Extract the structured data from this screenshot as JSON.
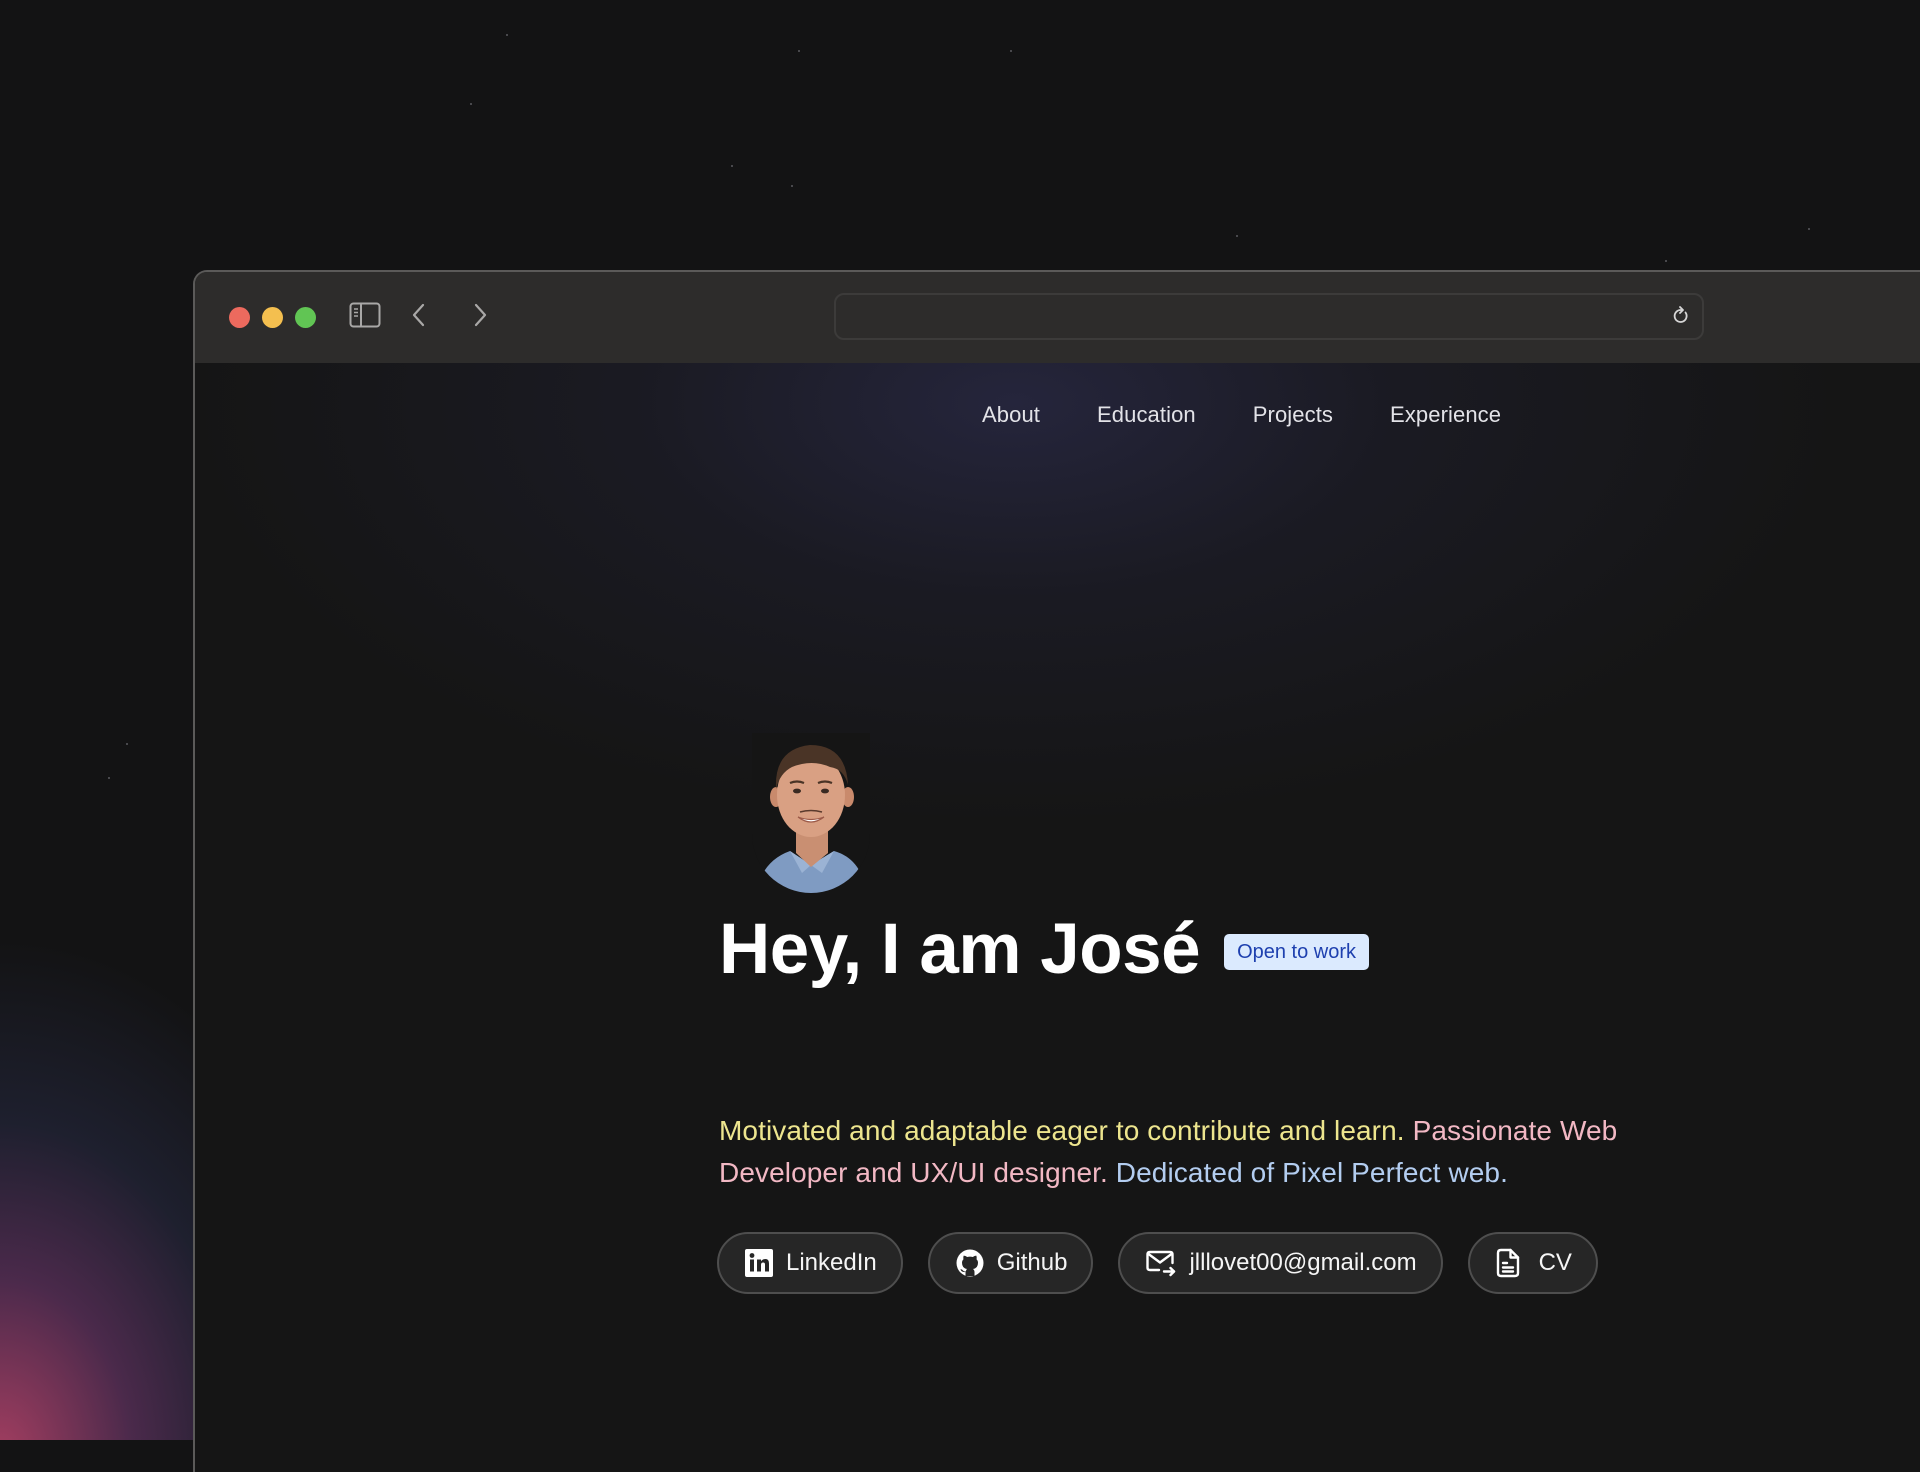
{
  "browser": {
    "traffic_lights": [
      "close",
      "minimize",
      "maximize"
    ],
    "toolbar_icons": [
      "sidebar-icon",
      "chevron-left-icon",
      "chevron-right-icon"
    ],
    "address_bar": {
      "value": "",
      "reload_icon": "reload-icon"
    }
  },
  "nav": {
    "items": [
      {
        "label": "About"
      },
      {
        "label": "Education"
      },
      {
        "label": "Projects"
      },
      {
        "label": "Experience"
      }
    ]
  },
  "hero": {
    "avatar_alt": "Profile photo of José",
    "title": "Hey, I am José",
    "badge": "Open to work",
    "description": {
      "part1": "Motivated and adaptable eager to contribute and learn.",
      "part2": "Passionate Web Developer and UX/UI designer.",
      "part3": "Dedicated of Pixel Perfect web."
    },
    "links": [
      {
        "label": "LinkedIn",
        "icon": "linkedin-icon"
      },
      {
        "label": "Github",
        "icon": "github-icon"
      },
      {
        "label": "jlllovet00@gmail.com",
        "icon": "mail-icon"
      },
      {
        "label": "CV",
        "icon": "document-icon"
      }
    ]
  },
  "colors": {
    "badge_bg": "#dbeafe",
    "badge_text": "#1e40af",
    "desc_yellow": "#ede58e",
    "desc_pink": "#f2b8c4",
    "desc_blue": "#b3cdf0"
  }
}
